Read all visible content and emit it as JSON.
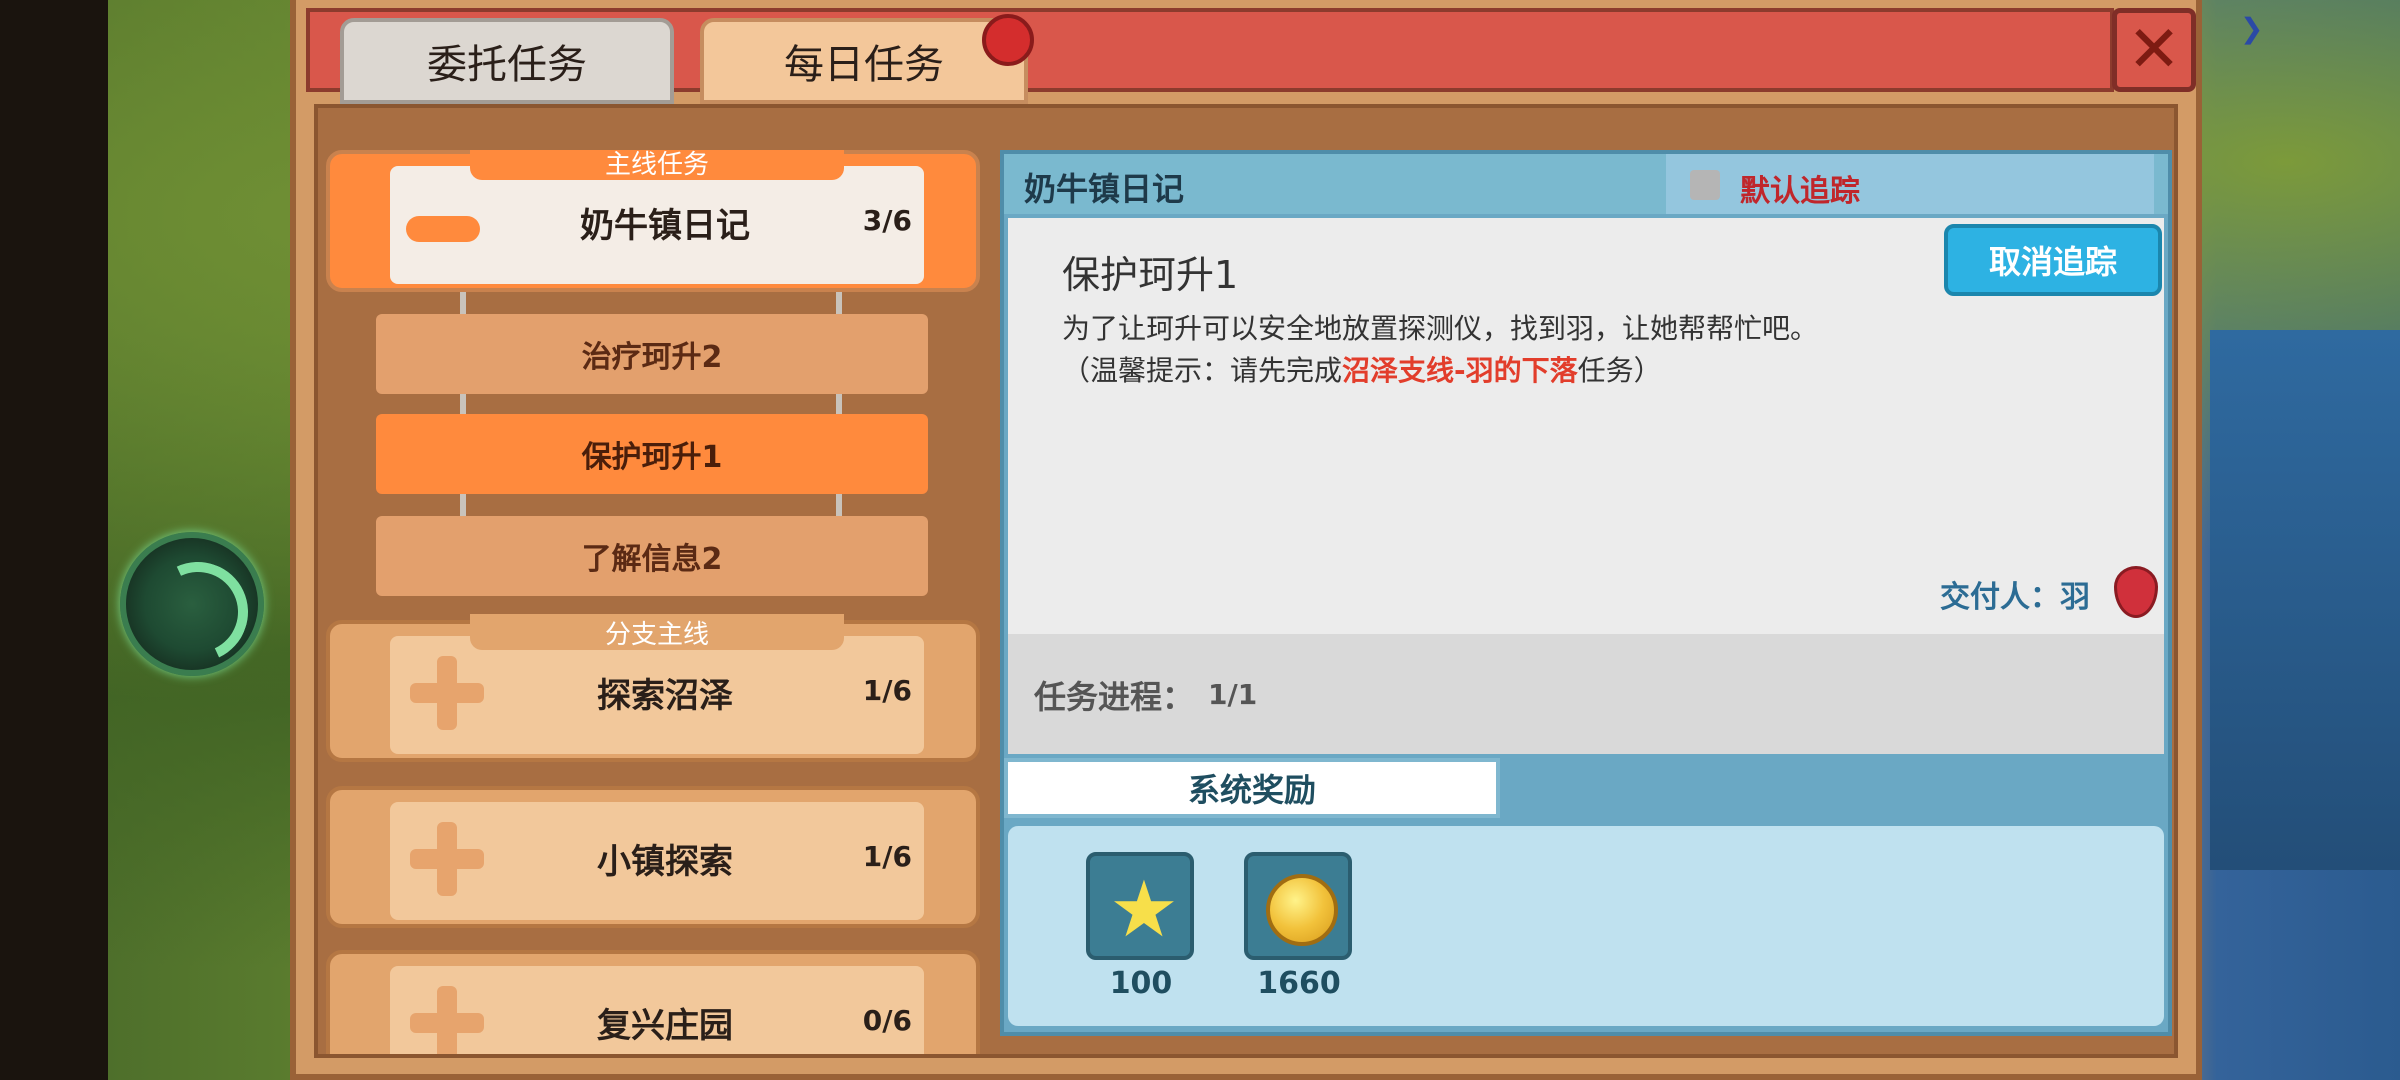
{
  "tabs": {
    "weituo": "委托任务",
    "meiri": "每日任务"
  },
  "left_list": {
    "main_group": {
      "tag": "主线任务",
      "title": "奶牛镇日记",
      "count": "3/6",
      "sub_items": [
        {
          "label": "治疗珂升2",
          "active": false
        },
        {
          "label": "保护珂升1",
          "active": true
        },
        {
          "label": "了解信息2",
          "active": false
        }
      ]
    },
    "branch_groups": [
      {
        "tag": "分支主线",
        "title": "探索沼泽",
        "count": "1/6"
      },
      {
        "tag": "",
        "title": "小镇探索",
        "count": "1/6"
      },
      {
        "tag": "",
        "title": "复兴庄园",
        "count": "0/6"
      }
    ]
  },
  "detail": {
    "header_title": "奶牛镇日记",
    "default_track_label": "默认追踪",
    "quest_title": "保护珂升1",
    "description_line1": "为了让珂升可以安全地放置探测仪，找到羽，让她帮帮忙吧。",
    "hint_prefix": "（温馨提示：请先完成",
    "hint_red": "沼泽支线-羽的下落",
    "hint_suffix": "任务）",
    "cancel_track_button": "取消追踪",
    "giver": "交付人：羽",
    "progress_label": "任务进程：",
    "progress_value": "1/1",
    "reward_tab": "系统奖励",
    "rewards": [
      {
        "icon": "star-icon",
        "amount": "100"
      },
      {
        "icon": "coin-icon",
        "amount": "1660"
      }
    ]
  }
}
